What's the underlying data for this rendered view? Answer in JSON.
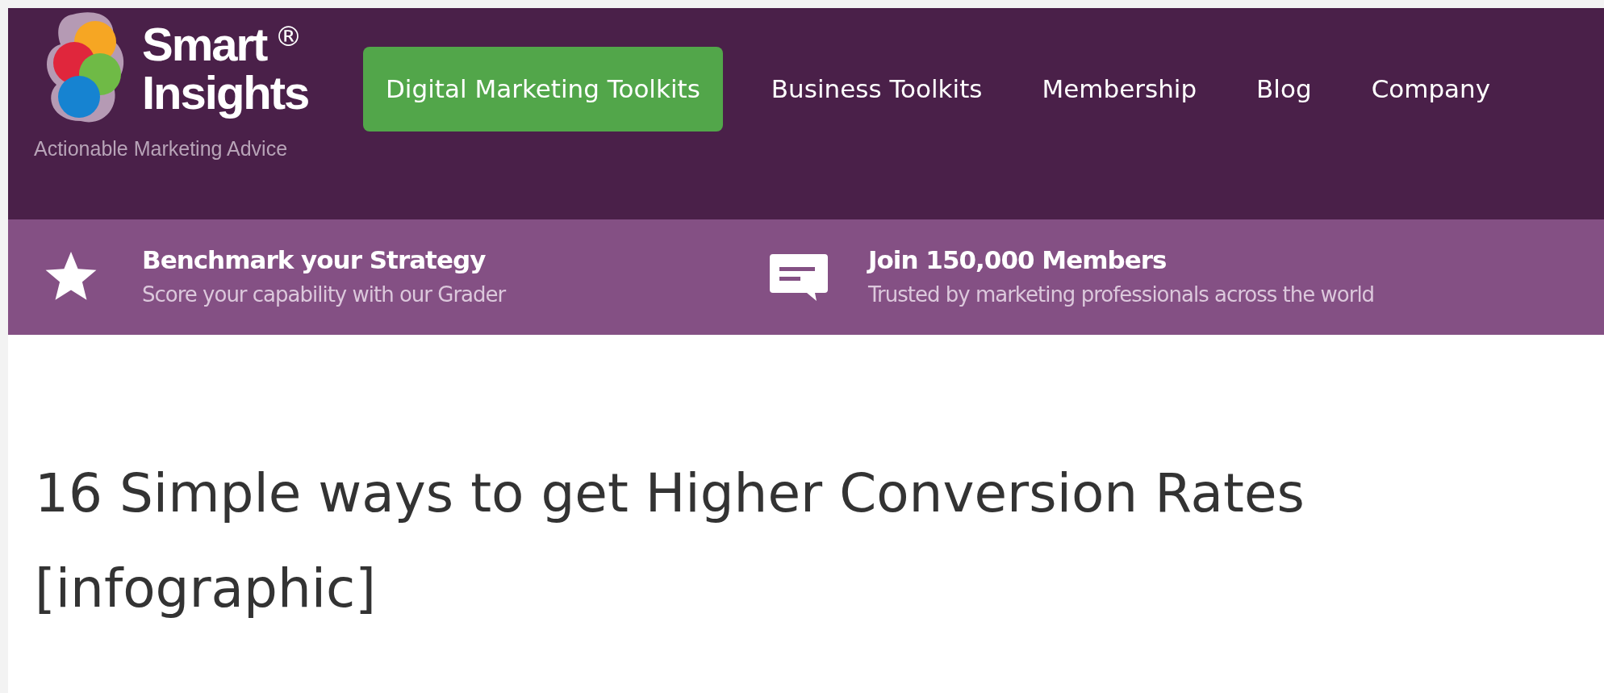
{
  "logo": {
    "line_1": "Smart",
    "mark": "®",
    "line_2": "Insights",
    "tagline": "Actionable Marketing Advice"
  },
  "nav": [
    {
      "label": "Digital Marketing Toolkits",
      "highlighted": true
    },
    {
      "label": "Business Toolkits",
      "highlighted": false
    },
    {
      "label": "Membership",
      "highlighted": false
    },
    {
      "label": "Blog",
      "highlighted": false
    },
    {
      "label": "Company",
      "highlighted": false
    }
  ],
  "promo_bar": [
    {
      "kind": "star",
      "title": "Benchmark your Strategy",
      "subtitle": "Score your capability with our Grader"
    },
    {
      "kind": "chat",
      "title": "Join 150,000 Members",
      "subtitle": "Trusted by marketing professionals across the world"
    }
  ],
  "article": {
    "title": "16 Simple ways to get Higher Conversion Rates [infographic]"
  }
}
